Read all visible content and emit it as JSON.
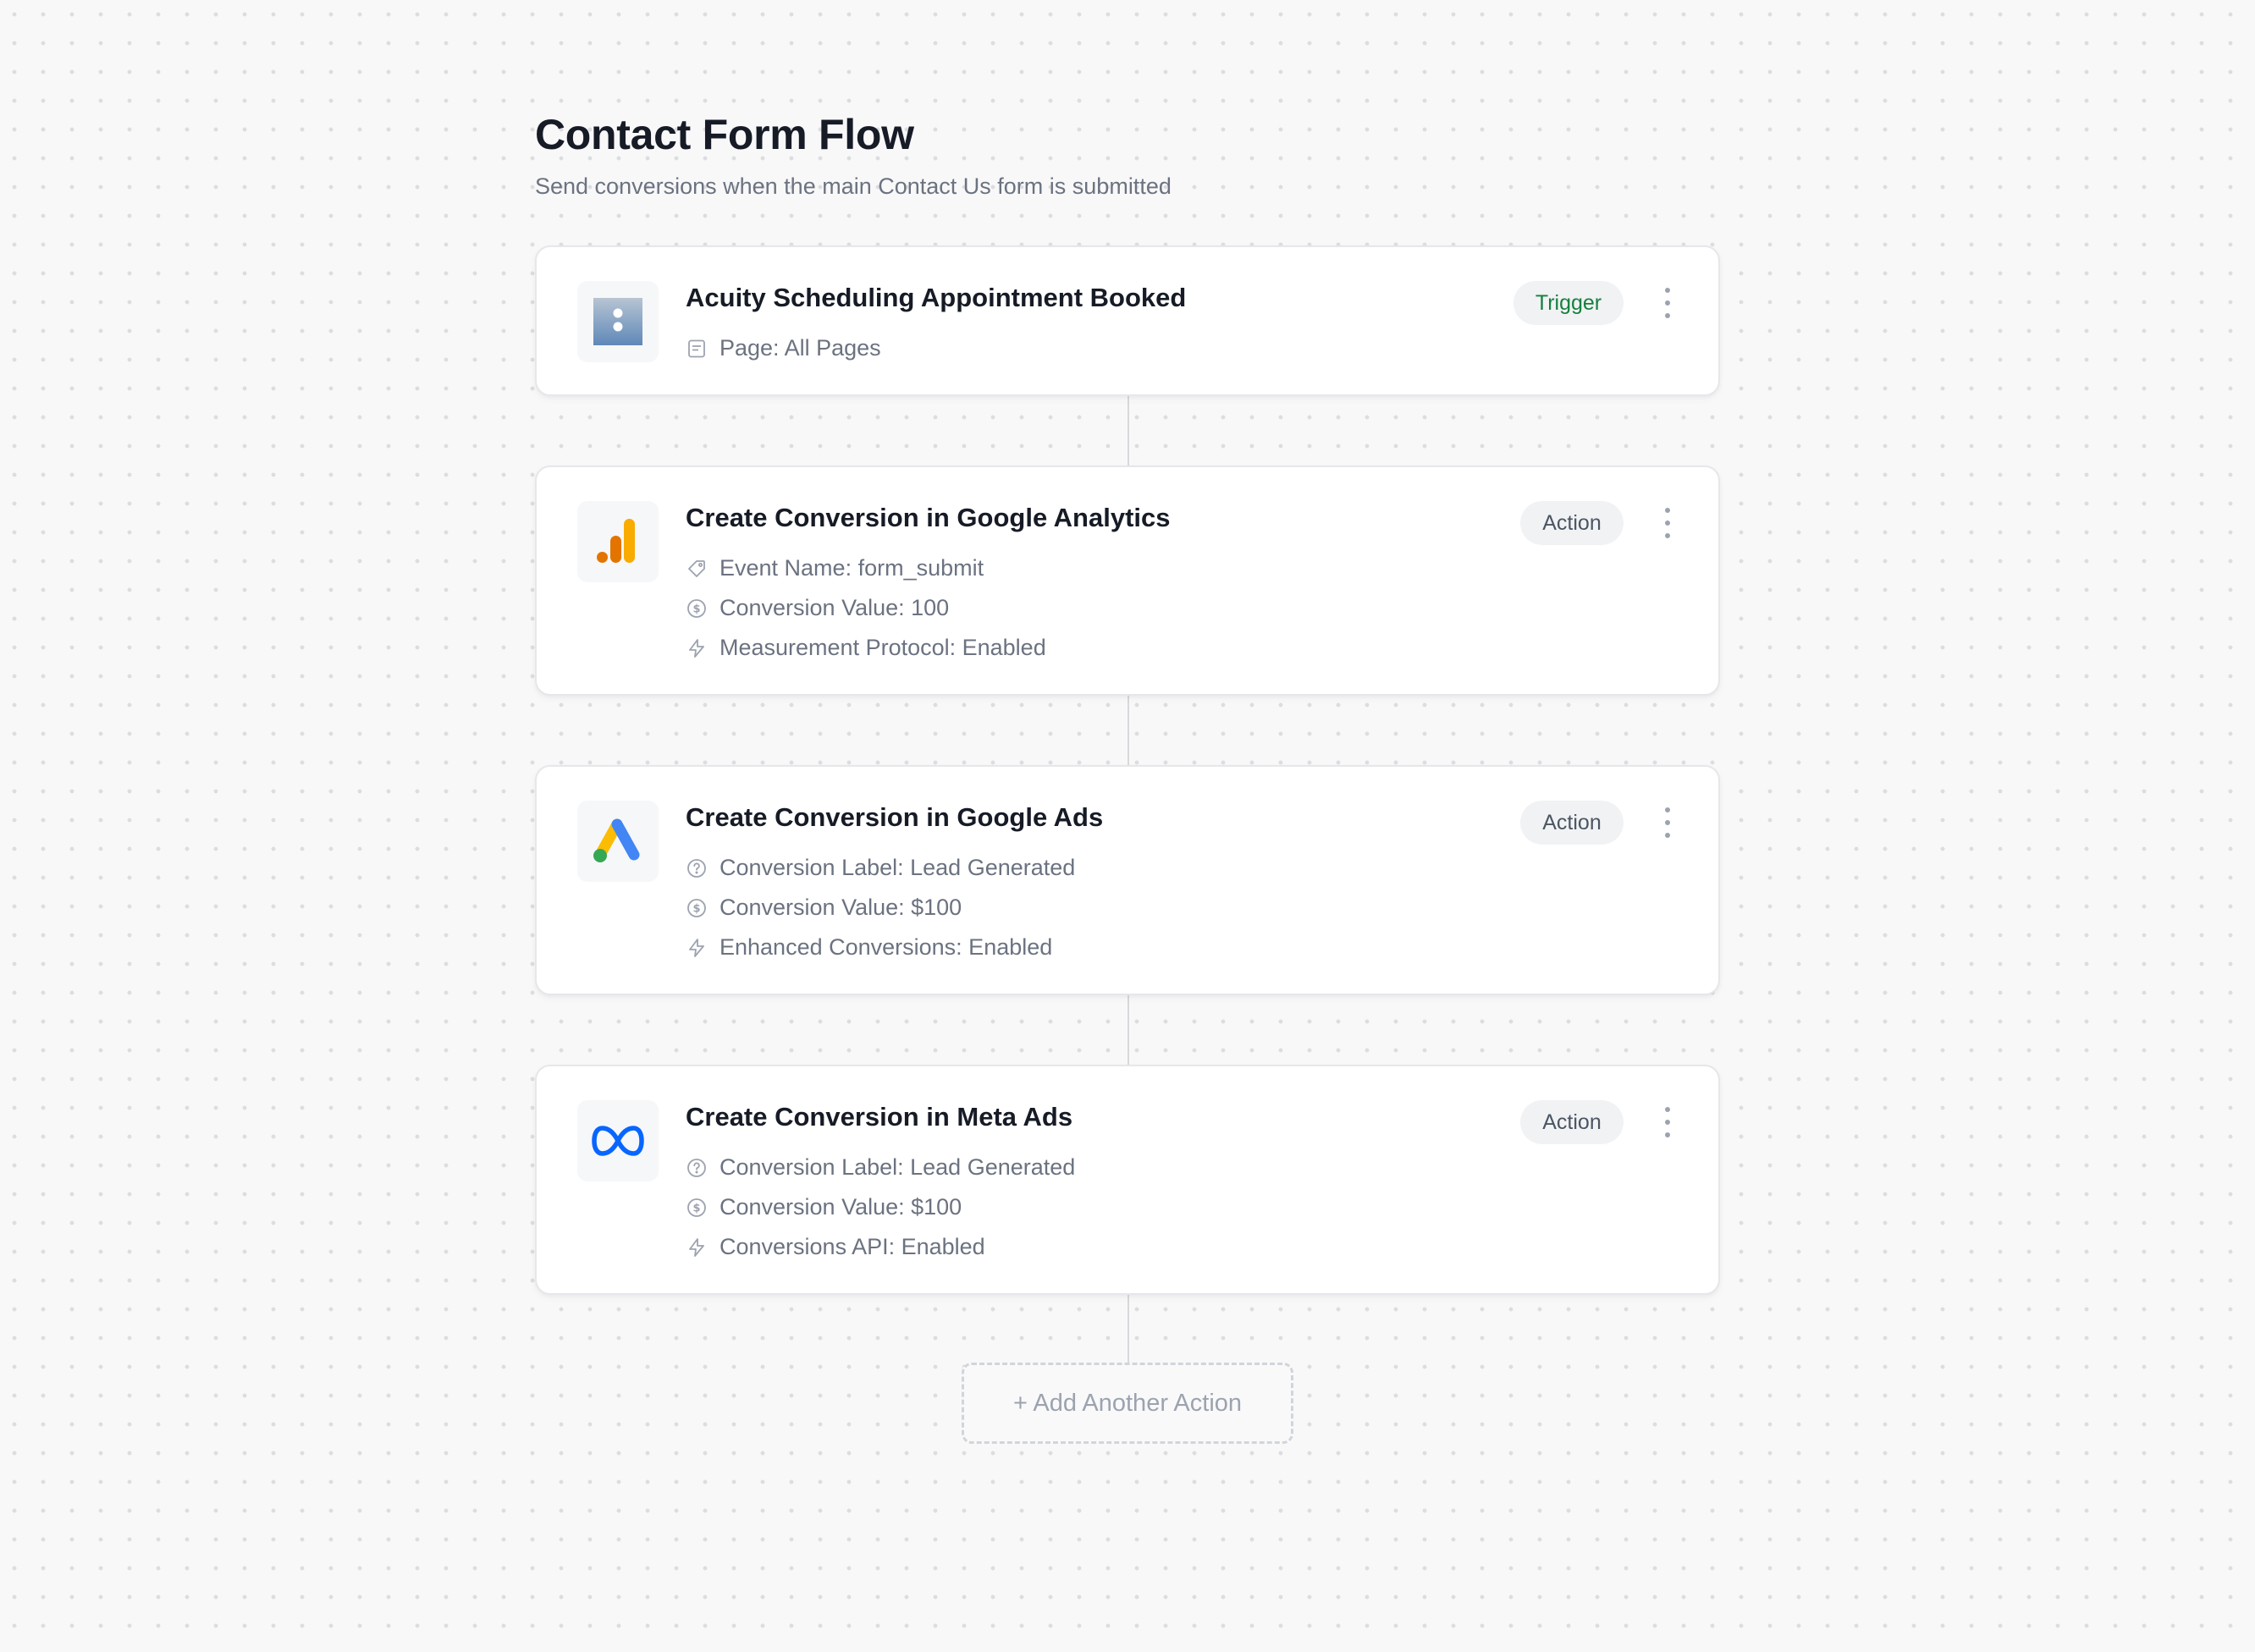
{
  "flow": {
    "title": "Contact Form Flow",
    "subtitle": "Send conversions when the main Contact Us form is submitted"
  },
  "steps": [
    {
      "title": "Acuity Scheduling Appointment Booked",
      "badge": "Trigger",
      "logo": "acuity-scheduling-logo",
      "details": [
        {
          "icon": "page-icon",
          "text": "Page: All Pages"
        }
      ]
    },
    {
      "title": "Create Conversion in Google Analytics",
      "badge": "Action",
      "logo": "google-analytics-logo",
      "details": [
        {
          "icon": "tag-icon",
          "text": "Event Name: form_submit"
        },
        {
          "icon": "dollar-circle-icon",
          "text": "Conversion Value: 100"
        },
        {
          "icon": "lightning-icon",
          "text": "Measurement Protocol: Enabled"
        }
      ]
    },
    {
      "title": "Create Conversion in Google Ads",
      "badge": "Action",
      "logo": "google-ads-logo",
      "details": [
        {
          "icon": "question-circle-icon",
          "text": "Conversion Label: Lead Generated"
        },
        {
          "icon": "dollar-circle-icon",
          "text": "Conversion Value: $100"
        },
        {
          "icon": "lightning-icon",
          "text": "Enhanced Conversions: Enabled"
        }
      ]
    },
    {
      "title": "Create Conversion in Meta Ads",
      "badge": "Action",
      "logo": "meta-logo",
      "details": [
        {
          "icon": "question-circle-icon",
          "text": "Conversion Label: Lead Generated"
        },
        {
          "icon": "dollar-circle-icon",
          "text": "Conversion Value: $100"
        },
        {
          "icon": "lightning-icon",
          "text": "Conversions API: Enabled"
        }
      ]
    }
  ],
  "add_action": {
    "label": "+ Add Another Action"
  },
  "colors": {
    "trigger_badge_text": "#15803d",
    "action_badge_text": "#4b5563",
    "google_analytics_orange": "#f9ab00",
    "google_analytics_dark_orange": "#e37400",
    "google_ads_yellow": "#fbbc04",
    "google_ads_blue": "#4285f4",
    "google_ads_green": "#34a853",
    "meta_blue": "#0866ff"
  }
}
